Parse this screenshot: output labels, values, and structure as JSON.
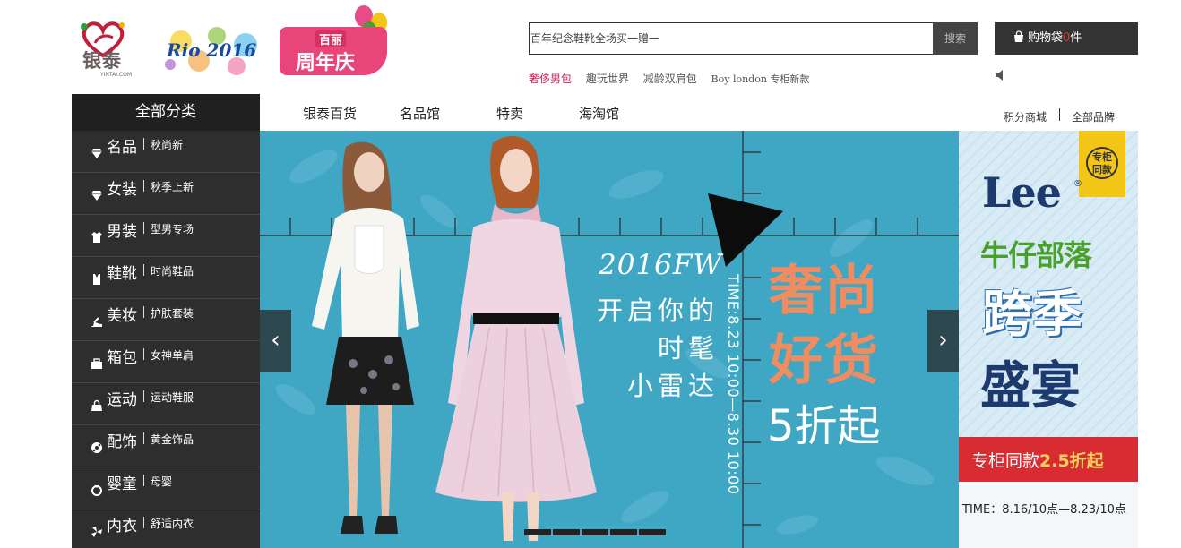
{
  "header": {
    "logo_cn": "银泰",
    "logo_en": "YINTAI.COM",
    "rio_text": "Rio 2016",
    "anniversary_small": "百丽",
    "anniversary_big": "周年庆"
  },
  "search": {
    "placeholder": "百年纪念鞋靴全场买一赠一",
    "button_label": "搜索"
  },
  "hot_keywords": [
    "奢侈男包",
    "趣玩世界",
    "减龄双肩包",
    "Boy london 专柜新款"
  ],
  "cart": {
    "label": "购物袋",
    "count": "0",
    "unit": "件"
  },
  "nav": {
    "all_categories": "全部分类",
    "items": [
      "银泰百货",
      "名品馆",
      "特卖",
      "海淘馆"
    ],
    "right_links": [
      "积分商城",
      "全部品牌"
    ]
  },
  "categories": [
    {
      "name": "名品",
      "sub": "秋尚新",
      "icon": "diamond-icon"
    },
    {
      "name": "女装",
      "sub": "秋季上新",
      "icon": "diamond-icon"
    },
    {
      "name": "男装",
      "sub": "型男专场",
      "icon": "shirt-icon"
    },
    {
      "name": "鞋靴",
      "sub": "时尚鞋品",
      "icon": "vest-icon"
    },
    {
      "name": "美妆",
      "sub": "护肤套装",
      "icon": "heel-icon"
    },
    {
      "name": "箱包",
      "sub": "女神单肩",
      "icon": "bag-icon"
    },
    {
      "name": "运动",
      "sub": "运动鞋服",
      "icon": "sport-bag-icon"
    },
    {
      "name": "配饰",
      "sub": "黄金饰品",
      "icon": "ball-icon"
    },
    {
      "name": "婴童",
      "sub": "母婴",
      "icon": "ring-icon"
    },
    {
      "name": "内衣",
      "sub": "舒适内衣",
      "icon": "fan-icon"
    }
  ],
  "banner": {
    "season": "2016FW",
    "slogan_line1": "开启你的",
    "slogan_line2": "时髦",
    "slogan_line3": "小雷达",
    "time": "TIME:8.23 10:00—8.30 10:00",
    "headline1": "奢尚",
    "headline2": "好货",
    "discount": "5折起",
    "prev_label": "‹",
    "next_label": "›",
    "slide_count": 5
  },
  "side_ad": {
    "tag": "专柜同款",
    "brand": "Lee",
    "brand_mark": "®",
    "tribe": "牛仔部落",
    "title1": "跨季",
    "title2": "盛宴",
    "offer_prefix": "专柜同款",
    "offer_value": "2.5折起",
    "time": "TIME：8.16/10点—8.23/10点"
  },
  "colors": {
    "accent": "#c8205a",
    "banner_bg": "#3fa7c4",
    "headline": "#ef8d60",
    "sidebar_bg": "#2e2e2e",
    "cart_bg": "#333333",
    "ad_red": "#d92b32"
  }
}
